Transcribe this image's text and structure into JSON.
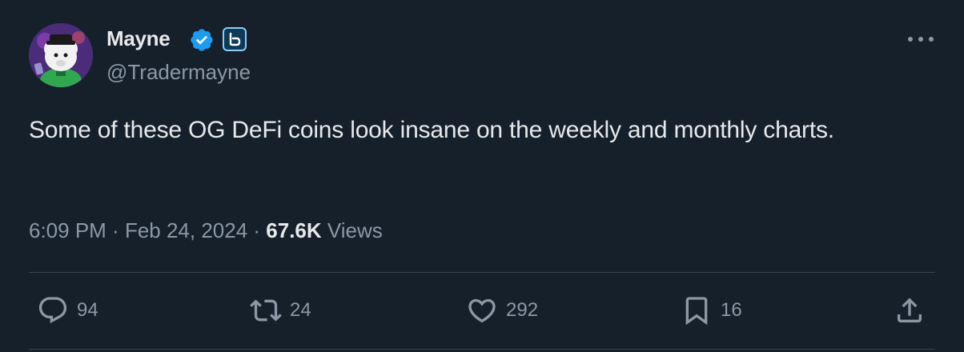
{
  "author": {
    "display_name": "Mayne",
    "handle": "@Tradermayne",
    "verified_icon": "verified-badge-icon",
    "affiliate_icon": "affiliate-badge-icon",
    "avatar_icon": "avatar-cartoon-icon"
  },
  "tweet": {
    "text": "Some of these OG DeFi coins look insane on the weekly and monthly charts.",
    "time": "6:09 PM",
    "separator1": " · ",
    "date": "Feb 24, 2024",
    "separator2": " · ",
    "views_count": "67.6K",
    "views_label": " Views"
  },
  "actions": {
    "replies": "94",
    "retweets": "24",
    "likes": "292",
    "bookmarks": "16"
  },
  "colors": {
    "background": "#15202b",
    "primary_text": "#e7e9ea",
    "secondary_text": "#8b98a5",
    "verified_blue": "#1d9bf0",
    "divider": "#38444d"
  }
}
